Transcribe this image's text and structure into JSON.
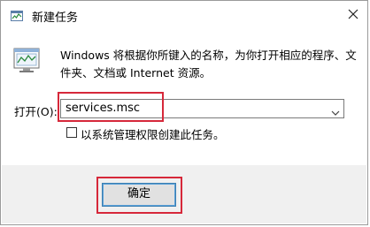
{
  "window": {
    "title": "新建任务",
    "close_icon": "close-icon"
  },
  "dialog": {
    "description": "Windows 将根据你所键入的名称，为你打开相应的程序、文件夹、文档或 Internet 资源。",
    "open_label": "打开(O):",
    "open_value": "services.msc",
    "admin_checkbox_label": "以系统管理权限创建此任务。",
    "admin_checkbox_checked": false,
    "ok_label": "确定"
  },
  "colors": {
    "highlight": "#d6283a",
    "footer_bg": "#f0f0f0",
    "button_border": "#3c7fb1"
  }
}
